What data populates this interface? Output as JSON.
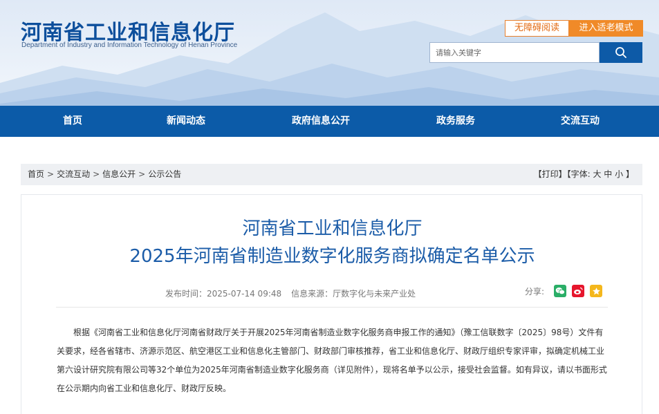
{
  "header": {
    "title": "河南省工业和信息化厅",
    "subtitle": "Department of Industry and Information Technology of Henan Province",
    "accessibility_label": "无障碍阅读",
    "elder_mode_label": "进入适老模式",
    "search": {
      "placeholder": "请输入关键字",
      "icon": "search-icon"
    }
  },
  "nav": {
    "items": [
      {
        "label": "首页"
      },
      {
        "label": "新闻动态"
      },
      {
        "label": "政府信息公开"
      },
      {
        "label": "政务服务"
      },
      {
        "label": "交流互动"
      }
    ]
  },
  "breadcrumb": {
    "items": [
      {
        "label": "首页"
      },
      {
        "label": "交流互动"
      },
      {
        "label": "信息公开"
      },
      {
        "label": "公示公告"
      }
    ],
    "separator": ">"
  },
  "tools": {
    "print_label": "【打印】",
    "font_prefix": "【字体:",
    "font_large": "大",
    "font_medium": "中",
    "font_small": "小",
    "font_suffix": "】"
  },
  "article": {
    "title_line1": "河南省工业和信息化厅",
    "title_line2": "2025年河南省制造业数字化服务商拟确定名单公示",
    "publish_time": "发布时间：2025-07-14 09:48",
    "source": "信息来源：厅数字化与未来产业处",
    "share_label": "分享:",
    "share_icons": [
      "wechat-icon",
      "weibo-icon",
      "favorite-icon"
    ],
    "body": "根据《河南省工业和信息化厅河南省财政厅关于开展2025年河南省制造业数字化服务商申报工作的通知》（豫工信联数字〔2025〕98号）文件有关要求，经各省辖市、济源示范区、航空港区工业和信息化主管部门、财政部门审核推荐，省工业和信息化厅、财政厅组织专家评审，拟确定机械工业第六设计研究院有限公司等32个单位为2025年河南省制造业数字化服务商（详见附件），现将名单予以公示，接受社会监督。如有异议，请以书面形式在公示期内向省工业和信息化厅、财政厅反映。"
  },
  "colors": {
    "brand_blue": "#0c5ba8",
    "title_blue": "#1b5ca8",
    "accent_orange": "#f08a28",
    "wechat_green": "#2aae67",
    "weibo_red": "#e6162d",
    "favorite_yellow": "#f4b71c"
  }
}
